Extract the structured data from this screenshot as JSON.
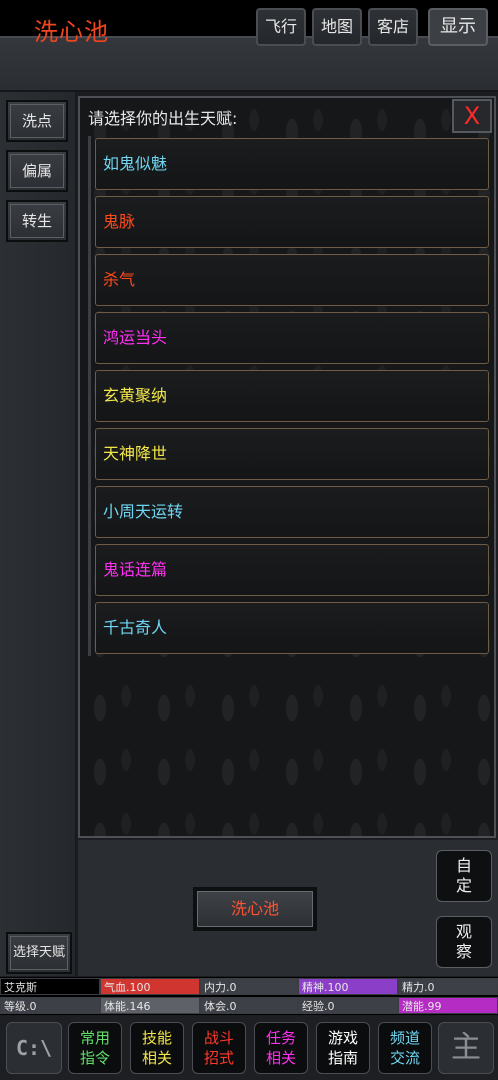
{
  "header": {
    "title": "洗心池",
    "buttons": [
      "飞行",
      "地图",
      "客店",
      "显示"
    ]
  },
  "sidebar": {
    "items": [
      "洗点",
      "偏属",
      "转生"
    ],
    "select_talent": "选择天赋"
  },
  "dialog": {
    "prompt": "请选择你的出生天赋:",
    "close": "X",
    "options": [
      {
        "label": "如鬼似魅",
        "color": "#6fd6f2"
      },
      {
        "label": "鬼脉",
        "color": "#ff4a1c"
      },
      {
        "label": "杀气",
        "color": "#ff4a1c"
      },
      {
        "label": "鸿运当头",
        "color": "#ff30f2"
      },
      {
        "label": "玄黄聚纳",
        "color": "#f2e64a"
      },
      {
        "label": "天神降世",
        "color": "#f2e64a"
      },
      {
        "label": "小周天运转",
        "color": "#6fd6f2"
      },
      {
        "label": "鬼话连篇",
        "color": "#ff30f2"
      },
      {
        "label": "千古奇人",
        "color": "#6fd6f2"
      }
    ]
  },
  "center_button": "洗心池",
  "side_buttons": {
    "custom": [
      "自",
      "定"
    ],
    "observe": [
      "观",
      "察"
    ]
  },
  "stats": {
    "name": "艾克斯",
    "hp": "气血.100",
    "neili": "内力.0",
    "jingshen": "精神.100",
    "jingli": "精力.0",
    "level": "等级.0",
    "tineng": "体能.146",
    "tihui": "体会.0",
    "exp": "经验.0",
    "potential": "潜能.99"
  },
  "bottom_nav": [
    {
      "line1": "常用",
      "line2": "指令",
      "color": "#62e06a"
    },
    {
      "line1": "技能",
      "line2": "相关",
      "color": "#f2e64a"
    },
    {
      "line1": "战斗",
      "line2": "招式",
      "color": "#ff3a2a"
    },
    {
      "line1": "任务",
      "line2": "相关",
      "color": "#ff30f2"
    },
    {
      "line1": "游戏",
      "line2": "指南",
      "color": "#ffffff"
    },
    {
      "line1": "频道",
      "line2": "交流",
      "color": "#6fd6f2"
    }
  ],
  "icons": {
    "command": "C:\\",
    "master": "主"
  }
}
